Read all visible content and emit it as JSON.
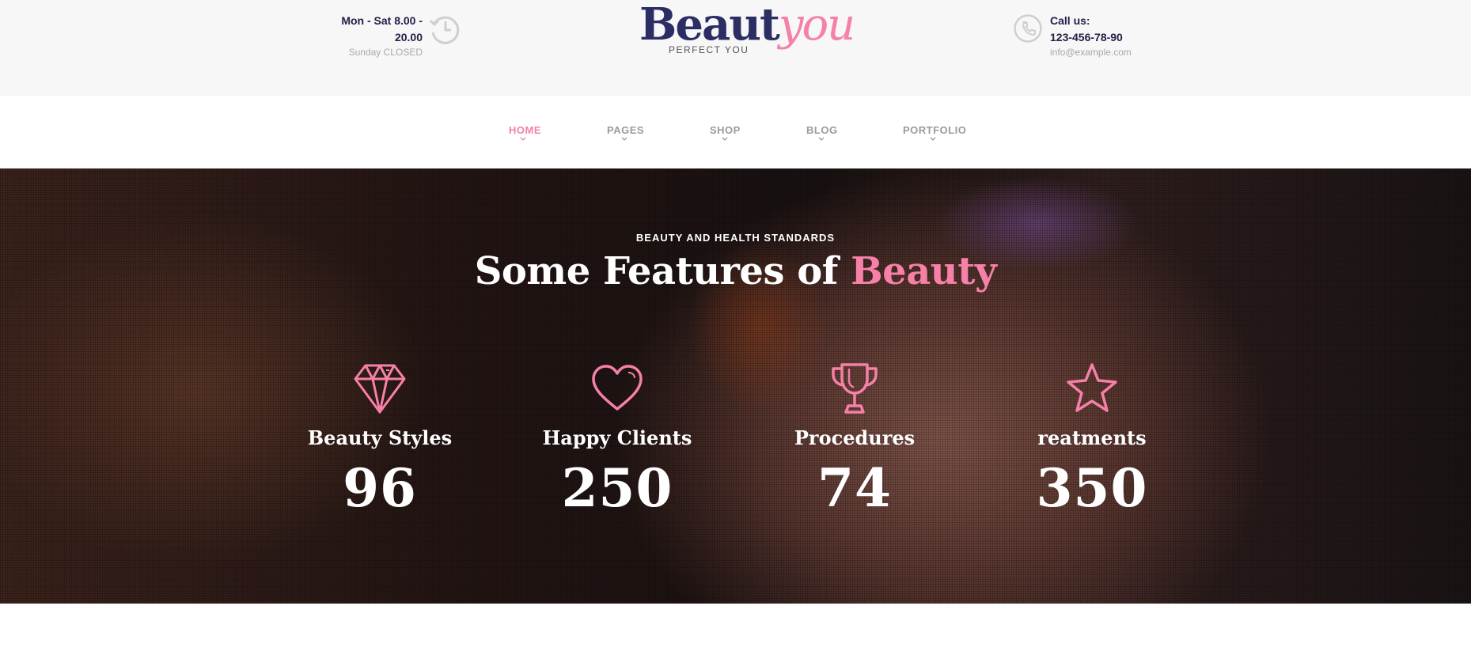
{
  "header": {
    "hours": {
      "line1": "Mon - Sat 8.00 - 20.00",
      "line2": "Sunday CLOSED",
      "icon": "clock-history-icon"
    },
    "logo": {
      "part1": "Beaut",
      "part2": "you",
      "tagline": "PERFECT YOU"
    },
    "contact": {
      "label": "Call us:",
      "phone": "123-456-78-90",
      "email": "info@example.com",
      "icon": "phone-icon"
    }
  },
  "nav": {
    "items": [
      {
        "label": "HOME",
        "active": true
      },
      {
        "label": "PAGES",
        "active": false
      },
      {
        "label": "SHOP",
        "active": false
      },
      {
        "label": "BLOG",
        "active": false
      },
      {
        "label": "PORTFOLIO",
        "active": false
      }
    ]
  },
  "hero": {
    "eyebrow": "BEAUTY AND HEALTH STANDARDS",
    "title_prefix": "Some Features of ",
    "title_accent": "Beauty",
    "features": [
      {
        "icon": "diamond-icon",
        "title": "Beauty Styles",
        "value": "96"
      },
      {
        "icon": "heart-icon",
        "title": "Happy Clients",
        "value": "250"
      },
      {
        "icon": "trophy-icon",
        "title": "Procedures",
        "value": "74"
      },
      {
        "icon": "star-icon",
        "title": "reatments",
        "value": "350"
      }
    ]
  },
  "colors": {
    "accent": "#f680a7",
    "brand_navy": "#2a2e62",
    "text_dark": "#232047",
    "muted": "#a8a8a8"
  }
}
